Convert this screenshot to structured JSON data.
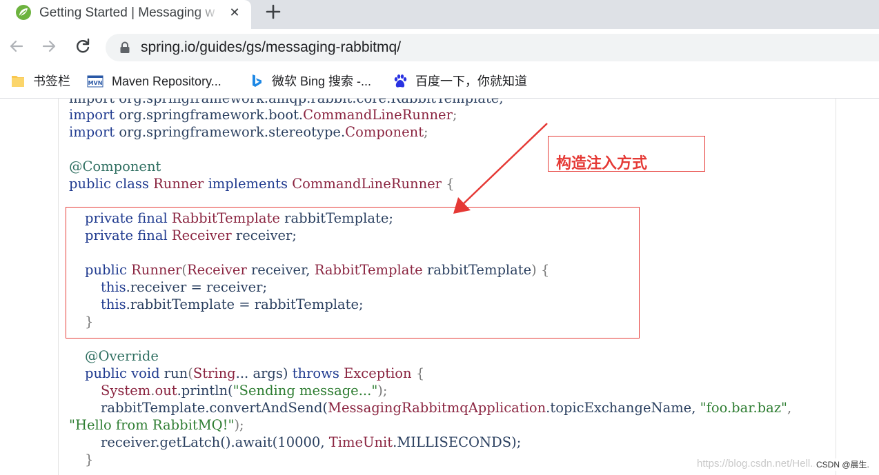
{
  "browser": {
    "tab": {
      "title": "Getting Started | Messaging w",
      "close": "✕"
    },
    "new_tab": "+",
    "address": {
      "url": "spring.io/guides/gs/messaging-rabbitmq/"
    },
    "bookmarks": [
      {
        "label": "书签栏",
        "icon": "folder-icon"
      },
      {
        "label": "Maven Repository...",
        "icon": "maven-icon"
      },
      {
        "label": "微软 Bing 搜索 -...",
        "icon": "bing-icon"
      },
      {
        "label": "百度一下，你就知道",
        "icon": "baidu-icon"
      }
    ]
  },
  "code": {
    "clipped_line": "import org.springframework.amqp.rabbit.core.RabbitTemplate;",
    "l_import1": {
      "kw": "import",
      "pkg": "org.springframework.boot.",
      "cls": "CommandLineRunner",
      "end": ";"
    },
    "l_import2": {
      "kw": "import",
      "pkg": "org.springframework.stereotype.",
      "cls": "Component",
      "end": ";"
    },
    "l_annot": "@Component",
    "l_class": {
      "kw": "public class",
      "name": "Runner",
      "impl": "implements",
      "iface": "CommandLineRunner",
      "brace": "{"
    },
    "l_field1": {
      "kw": "private final",
      "type": "RabbitTemplate",
      "name": "rabbitTemplate;"
    },
    "l_field2": {
      "kw": "private final",
      "type": "Receiver",
      "name": "receiver;"
    },
    "l_ctor": {
      "kw": "public",
      "name": "Runner",
      "p1t": "Receiver",
      "p1n": "receiver,",
      "p2t": "RabbitTemplate",
      "p2n": "rabbitTemplate",
      "brace": ") {"
    },
    "l_assign1": {
      "kw": "this",
      "rest": ".receiver = receiver;"
    },
    "l_assign2": {
      "kw": "this",
      "rest": ".rabbitTemplate = rabbitTemplate;"
    },
    "l_close1": "}",
    "l_override": "@Override",
    "l_run": {
      "kw": "public void",
      "name": "run",
      "open": "(",
      "ptype": "String",
      "pname": "... args)",
      "throws": "throws",
      "exc": "Exception",
      "brace": "{"
    },
    "l_println": {
      "obj": "System",
      "dot": ".",
      "field": "out",
      "call": ".println(",
      "str": "\"Sending message...\"",
      "end": ");"
    },
    "l_send": {
      "obj": "rabbitTemplate",
      "call": ".convertAndSend(",
      "cls": "MessagingRabbitmqApplication",
      "field": ".topicExchangeName,",
      "str": "\"foo.bar.baz\"",
      "end": ","
    },
    "l_send2": {
      "str": "\"Hello from RabbitMQ!\"",
      "end": ");"
    },
    "l_await": {
      "obj": "receiver",
      "call": ".getLatch().await(",
      "num": "10000,",
      "cls": "TimeUnit",
      "field": ".MILLISECONDS);"
    },
    "l_close2": "}"
  },
  "annotation": {
    "label": "构造注入方式",
    "color": "#e53935"
  },
  "watermark": "https://blog.csdn.net/Hell...",
  "csdn_tag": "CSDN @晨生."
}
